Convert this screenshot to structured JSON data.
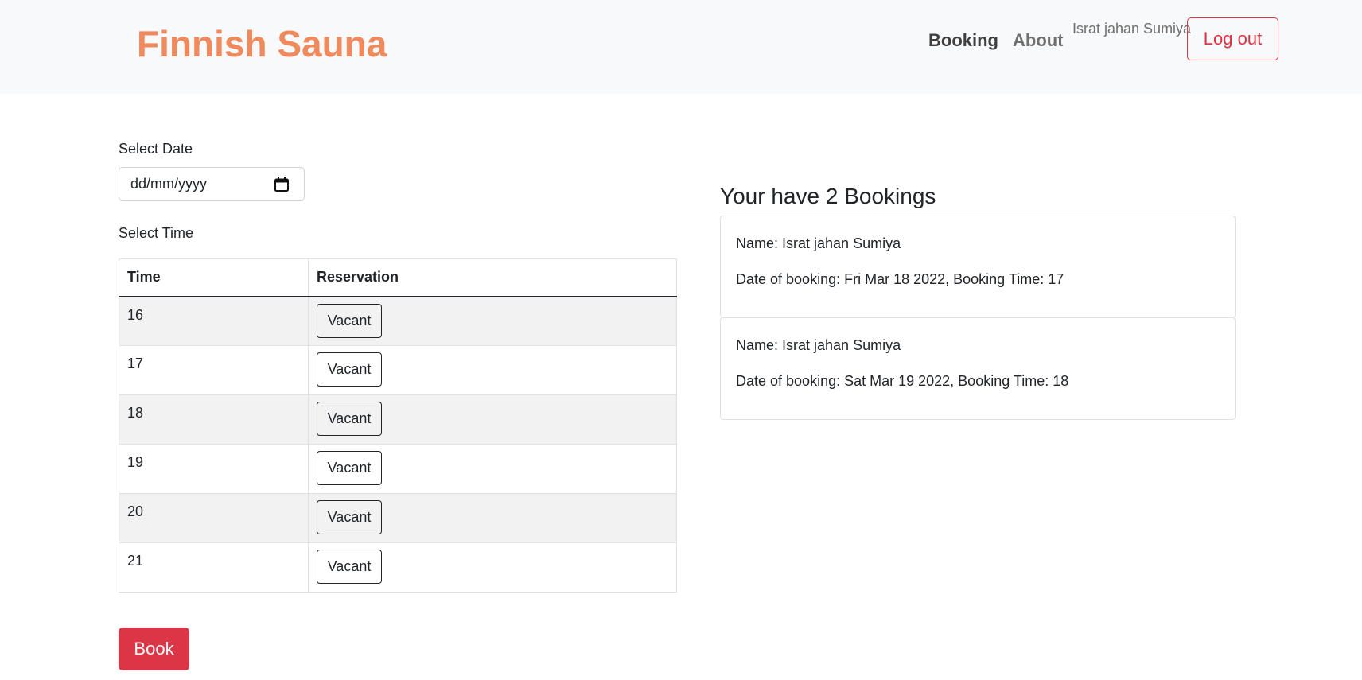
{
  "header": {
    "brand": "Finnish Sauna",
    "nav": {
      "booking": "Booking",
      "about": "About"
    },
    "username": "Israt jahan Sumiya",
    "logout_label": "Log out"
  },
  "form": {
    "date_label": "Select Date",
    "date_placeholder": "dd/mm/yyyy",
    "time_label": "Select Time",
    "table": {
      "headers": [
        "Time",
        "Reservation"
      ],
      "rows": [
        {
          "time": "16",
          "status": "Vacant"
        },
        {
          "time": "17",
          "status": "Vacant"
        },
        {
          "time": "18",
          "status": "Vacant"
        },
        {
          "time": "19",
          "status": "Vacant"
        },
        {
          "time": "20",
          "status": "Vacant"
        },
        {
          "time": "21",
          "status": "Vacant"
        }
      ]
    },
    "book_label": "Book"
  },
  "bookings": {
    "title": "Your have 2 Bookings",
    "items": [
      {
        "name": "Name: Israt jahan Sumiya",
        "details": "Date of booking: Fri Mar 18 2022, Booking Time: 17"
      },
      {
        "name": "Name: Israt jahan Sumiya",
        "details": "Date of booking: Sat Mar 19 2022, Booking Time: 18"
      }
    ]
  },
  "colors": {
    "brand": "#f08a5d",
    "danger": "#dc3545",
    "navbar_bg": "#f8f9fa",
    "stripe": "#f2f2f2"
  },
  "icons": {
    "date_picker": "calendar-icon"
  }
}
